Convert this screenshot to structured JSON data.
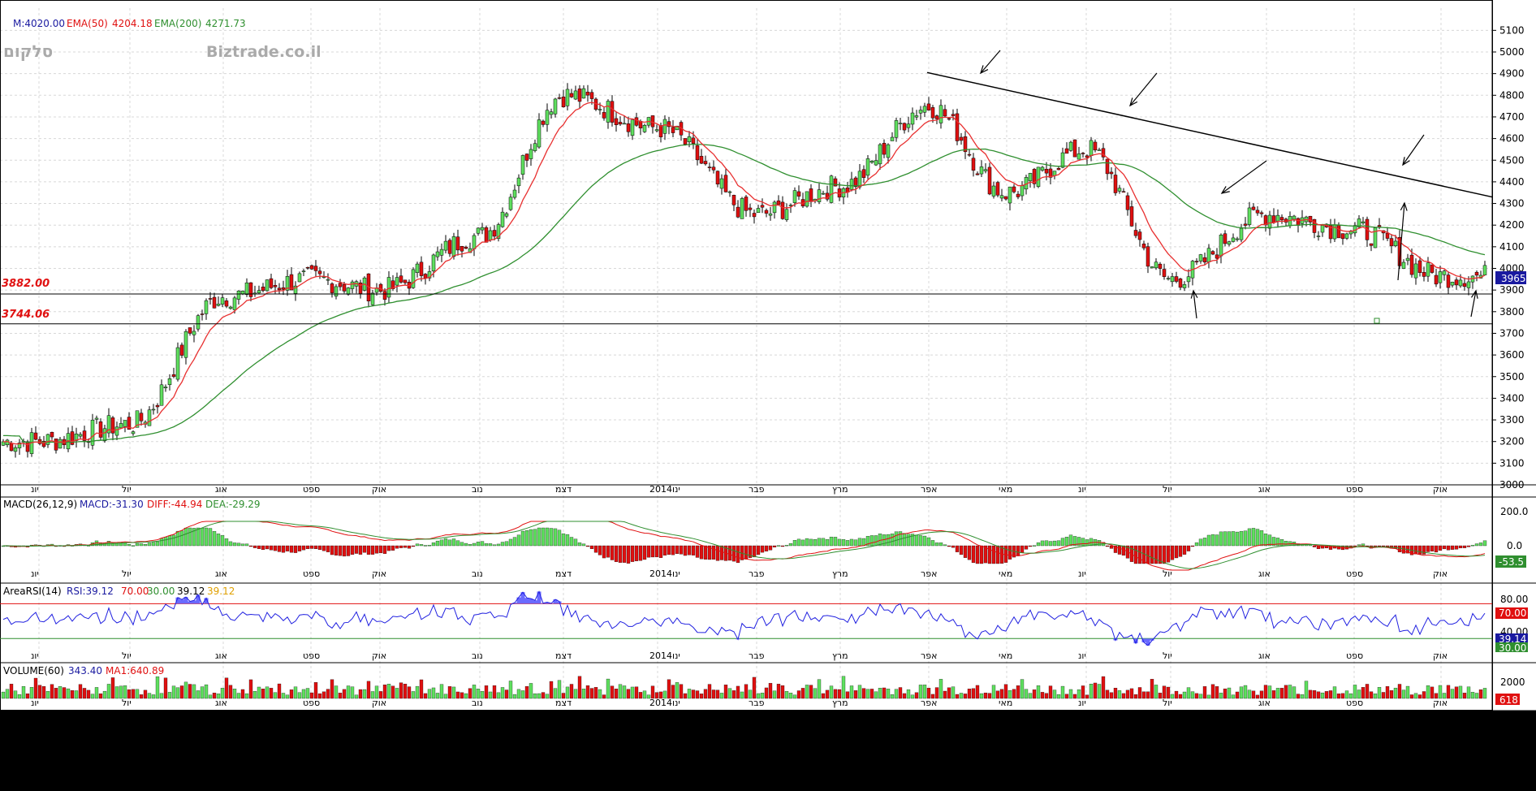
{
  "header": {
    "main_label": "M:4020.00",
    "ema50_label": "EMA(50)",
    "ema50_value": "4204.18",
    "ema200_label": "EMA(200)",
    "ema200_value": "4271.73",
    "symbol": "סלקום",
    "watermark": "Biztrade.co.il"
  },
  "colors": {
    "up": "#5fdf5f",
    "down": "#e01010",
    "ema50": "#e83030",
    "ema200": "#2f8f2f",
    "rsi": "#2020e0",
    "price_tag_bg": "#1a1aa0"
  },
  "levels": [
    {
      "label": "3882.00",
      "value": 3882
    },
    {
      "label": "3744.06",
      "value": 3744.06
    }
  ],
  "current_price_tag": "3965",
  "months": [
    "יונ",
    "יול",
    "אוג",
    "ספט",
    "אוק",
    "נוב",
    "דצמ",
    "2014ינו",
    "פבר",
    "מרץ",
    "אפר",
    "מאי",
    "יונ",
    "יול",
    "אוג",
    "ספט",
    "אוק"
  ],
  "price_ticks": [
    "5100",
    "5000",
    "4900",
    "4800",
    "4700",
    "4600",
    "4500",
    "4400",
    "4300",
    "4200",
    "4100",
    "4000",
    "3900",
    "3800",
    "3700",
    "3600",
    "3500",
    "3400",
    "3300",
    "3200",
    "3100",
    "3000"
  ],
  "macd": {
    "label": "MACD(26,12,9)",
    "macd_text": "MACD:-31.30",
    "diff_text": "DIFF:-44.94",
    "dea_text": "DEA:-29.29",
    "ticks": [
      "200.0",
      "0.0"
    ],
    "tag": "-53.5"
  },
  "rsi": {
    "label": "AreaRSI(14)",
    "rsi_text": "RSI:39.12",
    "upper_text": "70.00",
    "lower_text": "30.00",
    "val_text": "39.12",
    "val_text2": "39.12",
    "ticks": [
      "80.00",
      "40.00"
    ],
    "tag_70": "70.00",
    "tag_val": "39.14",
    "tag_30": "30.00"
  },
  "volume": {
    "label": "VOLUME(60)",
    "value_text": "343.40",
    "ma_text": "MA1:640.89",
    "tick": "2000",
    "tag": "618"
  },
  "chart_data": {
    "type": "candlestick",
    "title": "סלקום",
    "period": "Jun 2013 – Oct 2014 (daily)",
    "ylim": [
      3000,
      5200
    ],
    "support_levels": [
      3882.0,
      3744.06
    ],
    "trendline": {
      "from": [
        4900,
        "Apr 2014"
      ],
      "to": [
        4330,
        "Oct 2014"
      ]
    },
    "price_anchors": [
      {
        "month": "Jun 2013",
        "close": 3200
      },
      {
        "month": "Jul 2013",
        "close": 3280
      },
      {
        "month": "Aug 2013",
        "close": 3870
      },
      {
        "month": "Sep 2013",
        "close": 3950
      },
      {
        "month": "Oct 2013",
        "close": 3900
      },
      {
        "month": "Nov 2013",
        "close": 4150
      },
      {
        "month": "Dec 2013",
        "close": 4800
      },
      {
        "month": "Jan 2014",
        "close": 4650
      },
      {
        "month": "Feb 2014",
        "close": 4250
      },
      {
        "month": "Mar 2014",
        "close": 4380
      },
      {
        "month": "Apr 2014",
        "close": 4750
      },
      {
        "month": "May 2014",
        "close": 4350
      },
      {
        "month": "Jun 2014",
        "close": 4550
      },
      {
        "month": "Jul 2014",
        "close": 3950
      },
      {
        "month": "Aug 2014",
        "close": 4250
      },
      {
        "month": "Sep 2014",
        "close": 4180
      },
      {
        "month": "Oct 2014",
        "close": 3965
      }
    ],
    "series": [
      {
        "name": "EMA(50)",
        "last": 4204.18
      },
      {
        "name": "EMA(200)",
        "last": 4271.73
      }
    ],
    "indicators": {
      "macd": {
        "macd": -31.3,
        "diff": -44.94,
        "dea": -29.29
      },
      "rsi": {
        "value": 39.12,
        "upper": 70,
        "lower": 30
      },
      "volume": {
        "value": 343.4,
        "ma": 640.89
      }
    }
  }
}
